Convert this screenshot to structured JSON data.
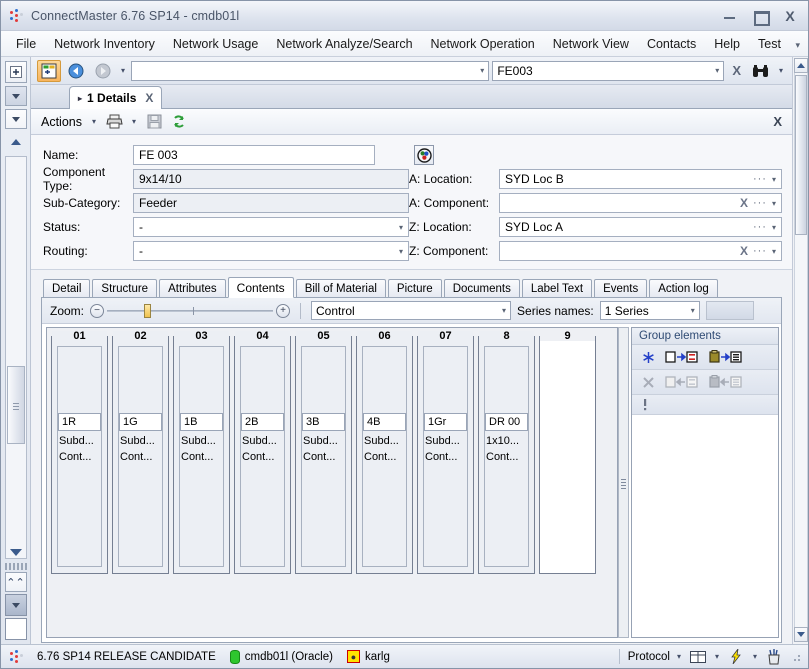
{
  "window": {
    "title": "ConnectMaster 6.76 SP14 - cmdb01l",
    "logo_colors": [
      "#e23b3b",
      "#2f6fd0",
      "#d0d5de"
    ],
    "controls": {
      "minimize": "minimize-button",
      "maximize": "maximize-button",
      "close": "X"
    }
  },
  "menubar": {
    "items": [
      {
        "label": "File"
      },
      {
        "label": "Network Inventory"
      },
      {
        "label": "Network Usage"
      },
      {
        "label": "Network Analyze/Search"
      },
      {
        "label": "Network Operation"
      },
      {
        "label": "Network View"
      },
      {
        "label": "Contacts"
      },
      {
        "label": "Help"
      },
      {
        "label": "Test"
      }
    ],
    "overflow": "▾"
  },
  "toolbar": {
    "icons": [
      {
        "name": "new-object-icon",
        "state": "active"
      },
      {
        "name": "back-arrow-icon",
        "state": "enabled"
      },
      {
        "name": "forward-arrow-icon",
        "state": "disabled"
      }
    ],
    "dropdown_caret": "▾",
    "search_combo": {
      "value": "",
      "caret": "▾"
    },
    "named_combo": {
      "value": "FE003",
      "caret": "▾",
      "clear": "X"
    },
    "find_icon": "binoculars-icon",
    "find_caret": "▾"
  },
  "doctab": {
    "arrow": "▸",
    "label": "1 Details",
    "close": "X"
  },
  "actionsbar": {
    "actions_label": "Actions",
    "actions_caret": "▾",
    "print_icon": "printer-icon",
    "print_caret": "▾",
    "save_icon": "save-disk-icon",
    "refresh_icon": "refresh-icon",
    "close": "X"
  },
  "form": {
    "left": [
      {
        "label": "Name:",
        "value": "FE 003",
        "type": "text",
        "readonly": false
      },
      {
        "label": "Component Type:",
        "value": "9x14/10",
        "type": "text",
        "readonly": true
      },
      {
        "label": "Sub-Category:",
        "value": "Feeder",
        "type": "text",
        "readonly": true
      },
      {
        "label": "Status:",
        "value": "-",
        "type": "combo",
        "readonly": false
      },
      {
        "label": "Routing:",
        "value": "-",
        "type": "combo",
        "readonly": false
      }
    ],
    "right": [
      {
        "label": "A: Location:",
        "value": "SYD Loc B",
        "has_clear": false,
        "dots": "···",
        "caret": "▾"
      },
      {
        "label": "A: Component:",
        "value": "",
        "has_clear": true,
        "clear": "X",
        "dots": "···",
        "caret": "▾"
      },
      {
        "label": "Z: Location:",
        "value": "SYD Loc A",
        "has_clear": false,
        "dots": "···",
        "caret": "▾"
      },
      {
        "label": "Z: Component:",
        "value": "",
        "has_clear": true,
        "clear": "X",
        "dots": "···",
        "caret": "▾"
      }
    ],
    "globe_icon": "color-wheel-icon"
  },
  "tabs": [
    {
      "label": "Detail",
      "active": false
    },
    {
      "label": "Structure",
      "active": false
    },
    {
      "label": "Attributes",
      "active": false
    },
    {
      "label": "Contents",
      "active": true
    },
    {
      "label": "Bill of Material",
      "active": false
    },
    {
      "label": "Picture",
      "active": false
    },
    {
      "label": "Documents",
      "active": false
    },
    {
      "label": "Label Text",
      "active": false
    },
    {
      "label": "Events",
      "active": false
    },
    {
      "label": "Action log",
      "active": false
    }
  ],
  "zoombar": {
    "label": "Zoom:",
    "minus": "−",
    "plus": "+",
    "slider_value": 22,
    "control_combo": {
      "value": "Control",
      "caret": "▾"
    },
    "series_label": "Series names:",
    "series_combo": {
      "value": "1 Series",
      "caret": "▾"
    }
  },
  "slots": [
    {
      "caption": "01",
      "box": "1R",
      "line1": "Subd...",
      "line2": "Cont...",
      "empty": false
    },
    {
      "caption": "02",
      "box": "1G",
      "line1": "Subd...",
      "line2": "Cont...",
      "empty": false
    },
    {
      "caption": "03",
      "box": "1B",
      "line1": "Subd...",
      "line2": "Cont...",
      "empty": false
    },
    {
      "caption": "04",
      "box": "2B",
      "line1": "Subd...",
      "line2": "Cont...",
      "empty": false
    },
    {
      "caption": "05",
      "box": "3B",
      "line1": "Subd...",
      "line2": "Cont...",
      "empty": false
    },
    {
      "caption": "06",
      "box": "4B",
      "line1": "Subd...",
      "line2": "Cont...",
      "empty": false
    },
    {
      "caption": "07",
      "box": "1Gr",
      "line1": "Subd...",
      "line2": "Cont...",
      "empty": false
    },
    {
      "caption": "8",
      "box": "DR 00",
      "line1": "1x10...",
      "line2": "Cont...",
      "empty": false
    },
    {
      "caption": "9",
      "box": "",
      "line1": "",
      "line2": "",
      "empty": true
    }
  ],
  "group_panel": {
    "header": "Group elements",
    "row1_icons": [
      "snowflake-icon",
      "component-to-list-icon",
      "clipboard-to-list-icon"
    ],
    "row2_icons": [
      "delete-x-icon",
      "list-to-component-icon",
      "list-to-clipboard-icon"
    ],
    "row3_icons": [
      "info-exclamation-icon"
    ]
  },
  "statusbar": {
    "version": "6.76 SP14 RELEASE CANDIDATE",
    "database": "cmdb01l (Oracle)",
    "user": "karlg",
    "protocol_label": "Protocol",
    "protocol_caret": "▾",
    "layout_icon": "window-layout-icon",
    "layout_caret": "▾",
    "bolt_icon": "lightning-bolt-icon",
    "bolt_caret": "▾",
    "tools_icon": "pencil-cup-icon"
  },
  "colors": {
    "accent_orange": "#f8b45c",
    "accent_blue": "#2f6fd0",
    "panel_bg": "#f6f7fa",
    "header_text": "#2e4a73"
  }
}
